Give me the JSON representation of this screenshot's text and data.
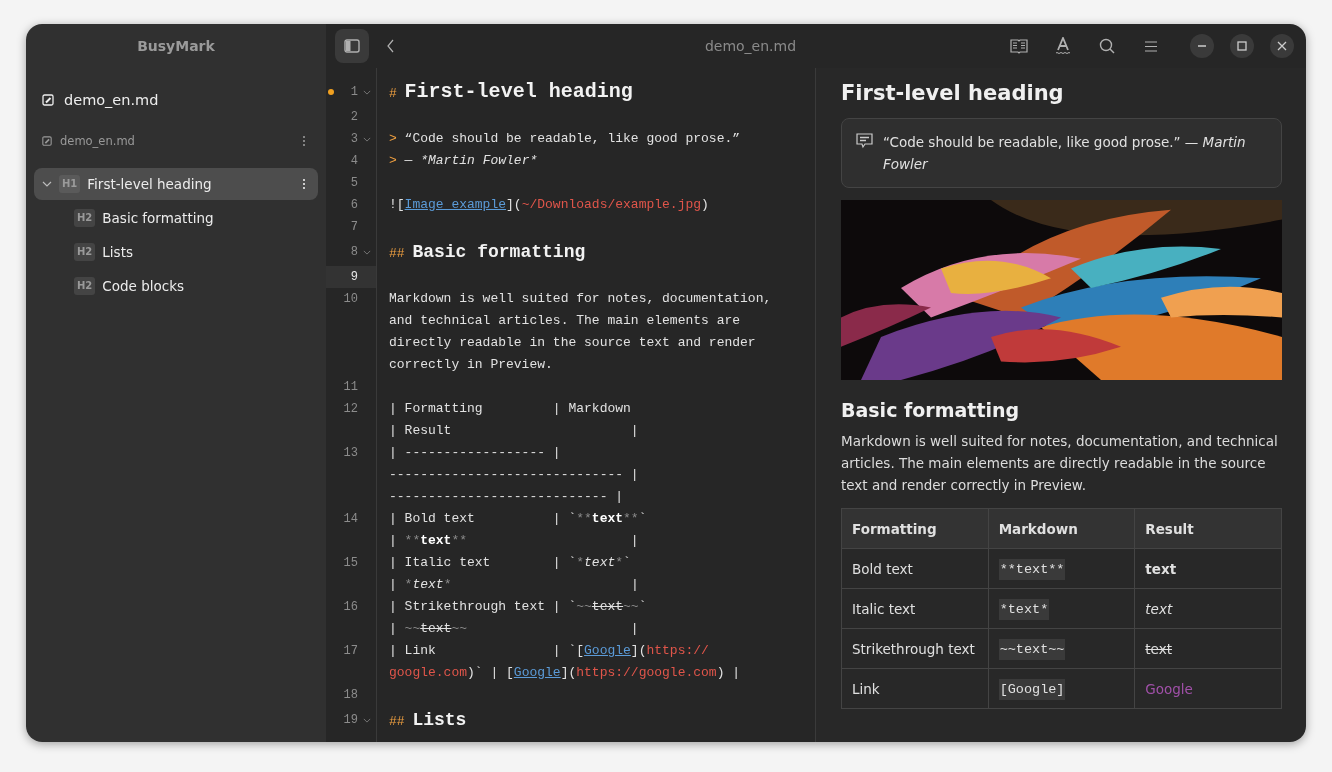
{
  "sidebar": {
    "app_title": "BusyMark",
    "file": "demo_en.md",
    "document": "demo_en.md",
    "outline": [
      {
        "level": "H1",
        "title": "First-level heading",
        "selected": true,
        "expanded": true,
        "children": [
          {
            "level": "H2",
            "title": "Basic formatting",
            "selected": false
          },
          {
            "level": "H2",
            "title": "Lists",
            "selected": false
          },
          {
            "level": "H2",
            "title": "Code blocks",
            "selected": false
          }
        ]
      }
    ]
  },
  "header": {
    "sidebar_toggle": {
      "on": true
    },
    "title": "demo_en.md"
  },
  "editor": {
    "lines": [
      {
        "number": "1",
        "fold": true,
        "modified": true,
        "current": false,
        "rows": [
          {
            "spans": [
              {
                "kind": "marker",
                "text": "#"
              },
              {
                "kind": "h1",
                "text": "First-level heading"
              }
            ]
          }
        ]
      },
      {
        "number": "2",
        "fold": false,
        "modified": false,
        "current": false
      },
      {
        "number": "3",
        "fold": true,
        "modified": false,
        "current": false,
        "rows": [
          {
            "spans": [
              {
                "kind": "marker",
                "text": ">"
              },
              {
                "kind": "text",
                "text": "“Code should be readable, like good prose.”"
              }
            ]
          }
        ]
      },
      {
        "number": "4",
        "fold": false,
        "modified": false,
        "current": false,
        "rows": [
          {
            "spans": [
              {
                "kind": "marker",
                "text": ">"
              },
              {
                "kind": "text",
                "text": "— "
              },
              {
                "kind": "italic",
                "text": "*Martin Fowler*"
              }
            ]
          }
        ]
      },
      {
        "number": "5",
        "fold": false,
        "modified": false,
        "current": false
      },
      {
        "number": "6",
        "fold": false,
        "modified": false,
        "current": false,
        "rows": [
          {
            "spans": [
              {
                "kind": "text",
                "text": "!["
              },
              {
                "kind": "link",
                "text": "Image example"
              },
              {
                "kind": "text",
                "text": "]("
              },
              {
                "kind": "url",
                "text": "~/Downloads/example.jpg"
              },
              {
                "kind": "text",
                "text": ")"
              }
            ]
          }
        ]
      },
      {
        "number": "7",
        "fold": false,
        "modified": false,
        "current": false
      },
      {
        "number": "8",
        "fold": true,
        "modified": false,
        "current": false,
        "rows": [
          {
            "spans": [
              {
                "kind": "marker",
                "text": "##"
              },
              {
                "kind": "h2",
                "text": "Basic formatting"
              }
            ]
          }
        ]
      },
      {
        "number": "9",
        "fold": false,
        "modified": false,
        "current": true
      },
      {
        "number": "10",
        "fold": false,
        "modified": false,
        "current": false,
        "rows": [
          {
            "spans": [
              {
                "kind": "text",
                "text": "Markdown is well suited for notes, documentation,"
              }
            ]
          },
          {
            "spans": [
              {
                "kind": "text",
                "text": "and technical articles. The main elements are"
              }
            ]
          },
          {
            "spans": [
              {
                "kind": "text",
                "text": "directly readable in the source text and render"
              }
            ]
          },
          {
            "spans": [
              {
                "kind": "text",
                "text": "correctly in Preview."
              }
            ]
          }
        ]
      },
      {
        "number": "11",
        "fold": false,
        "modified": false,
        "current": false
      },
      {
        "number": "12",
        "fold": false,
        "modified": false,
        "current": false,
        "rows": [
          {
            "spans": [
              {
                "kind": "text",
                "text": "| Formatting         | Markdown"
              }
            ]
          },
          {
            "spans": [
              {
                "kind": "text",
                "text": "| Result                       |"
              }
            ]
          }
        ]
      },
      {
        "number": "13",
        "fold": false,
        "modified": false,
        "current": false,
        "rows": [
          {
            "spans": [
              {
                "kind": "text",
                "text": "| ------------------ |"
              }
            ]
          },
          {
            "spans": [
              {
                "kind": "text",
                "text": "------------------------------ |"
              }
            ]
          },
          {
            "spans": [
              {
                "kind": "text",
                "text": "---------------------------- |"
              }
            ]
          }
        ]
      },
      {
        "number": "14",
        "fold": false,
        "modified": false,
        "current": false,
        "rows": [
          {
            "spans": [
              {
                "kind": "text",
                "text": "| Bold text          | `"
              },
              {
                "kind": "dim",
                "text": "**"
              },
              {
                "kind": "bold",
                "text": "text"
              },
              {
                "kind": "dim",
                "text": "**"
              },
              {
                "kind": "text",
                "text": "`"
              }
            ]
          },
          {
            "spans": [
              {
                "kind": "text",
                "text": "| "
              },
              {
                "kind": "dim",
                "text": "**"
              },
              {
                "kind": "bold",
                "text": "text"
              },
              {
                "kind": "dim",
                "text": "**"
              },
              {
                "kind": "text",
                "text": "                     |"
              }
            ]
          }
        ]
      },
      {
        "number": "15",
        "fold": false,
        "modified": false,
        "current": false,
        "rows": [
          {
            "spans": [
              {
                "kind": "text",
                "text": "| Italic text        | `"
              },
              {
                "kind": "dim",
                "text": "*"
              },
              {
                "kind": "italic",
                "text": "text"
              },
              {
                "kind": "dim",
                "text": "*"
              },
              {
                "kind": "text",
                "text": "`"
              }
            ]
          },
          {
            "spans": [
              {
                "kind": "text",
                "text": "| "
              },
              {
                "kind": "dim",
                "text": "*"
              },
              {
                "kind": "italic",
                "text": "text"
              },
              {
                "kind": "dim",
                "text": "*"
              },
              {
                "kind": "text",
                "text": "                       |"
              }
            ]
          }
        ]
      },
      {
        "number": "16",
        "fold": false,
        "modified": false,
        "current": false,
        "rows": [
          {
            "spans": [
              {
                "kind": "text",
                "text": "| Strikethrough text | `"
              },
              {
                "kind": "dim",
                "text": "~~"
              },
              {
                "kind": "strike",
                "text": "text"
              },
              {
                "kind": "dim",
                "text": "~~"
              },
              {
                "kind": "text",
                "text": "`"
              }
            ]
          },
          {
            "spans": [
              {
                "kind": "text",
                "text": "| "
              },
              {
                "kind": "dim",
                "text": "~~"
              },
              {
                "kind": "strike",
                "text": "text"
              },
              {
                "kind": "dim",
                "text": "~~"
              },
              {
                "kind": "text",
                "text": "                     |"
              }
            ]
          }
        ]
      },
      {
        "number": "17",
        "fold": false,
        "modified": false,
        "current": false,
        "rows": [
          {
            "spans": [
              {
                "kind": "text",
                "text": "| Link               | `["
              },
              {
                "kind": "link",
                "text": "Google"
              },
              {
                "kind": "text",
                "text": "]("
              },
              {
                "kind": "url",
                "text": "https://"
              }
            ]
          },
          {
            "spans": [
              {
                "kind": "url",
                "text": "google.com"
              },
              {
                "kind": "text",
                "text": ")` | ["
              },
              {
                "kind": "link",
                "text": "Google"
              },
              {
                "kind": "text",
                "text": "]("
              },
              {
                "kind": "url",
                "text": "https://google.com"
              },
              {
                "kind": "text",
                "text": ") |"
              }
            ]
          }
        ]
      },
      {
        "number": "18",
        "fold": false,
        "modified": false,
        "current": false
      },
      {
        "number": "19",
        "fold": true,
        "modified": false,
        "current": false,
        "rows": [
          {
            "spans": [
              {
                "kind": "marker",
                "text": "##"
              },
              {
                "kind": "h2",
                "text": "Lists"
              }
            ]
          }
        ]
      }
    ]
  },
  "preview": {
    "heading": "First-level heading",
    "quote": "“Code should be readable, like good prose.” — *Martin Fowler*",
    "subheading": "Basic formatting",
    "paragraph": "Markdown is well suited for notes, documentation, and technical articles. The main elements are directly readable in the source text and render correctly in Preview.",
    "table": {
      "columns": [
        "Formatting",
        "Markdown",
        "Result"
      ],
      "rows": [
        [
          {
            "kind": "text",
            "text": "Bold text"
          },
          {
            "kind": "code",
            "text": "**text**"
          },
          {
            "kind": "bold",
            "text": "text"
          }
        ],
        [
          {
            "kind": "text",
            "text": "Italic text"
          },
          {
            "kind": "code",
            "text": "*text*"
          },
          {
            "kind": "italic",
            "text": "text"
          }
        ],
        [
          {
            "kind": "text",
            "text": "Strikethrough text"
          },
          {
            "kind": "code",
            "text": "~~text~~"
          },
          {
            "kind": "strike",
            "text": "text"
          }
        ],
        [
          {
            "kind": "text",
            "text": "Link"
          },
          {
            "kind": "code",
            "text": "[Google]"
          },
          {
            "kind": "link",
            "text": "Google"
          }
        ]
      ]
    }
  }
}
